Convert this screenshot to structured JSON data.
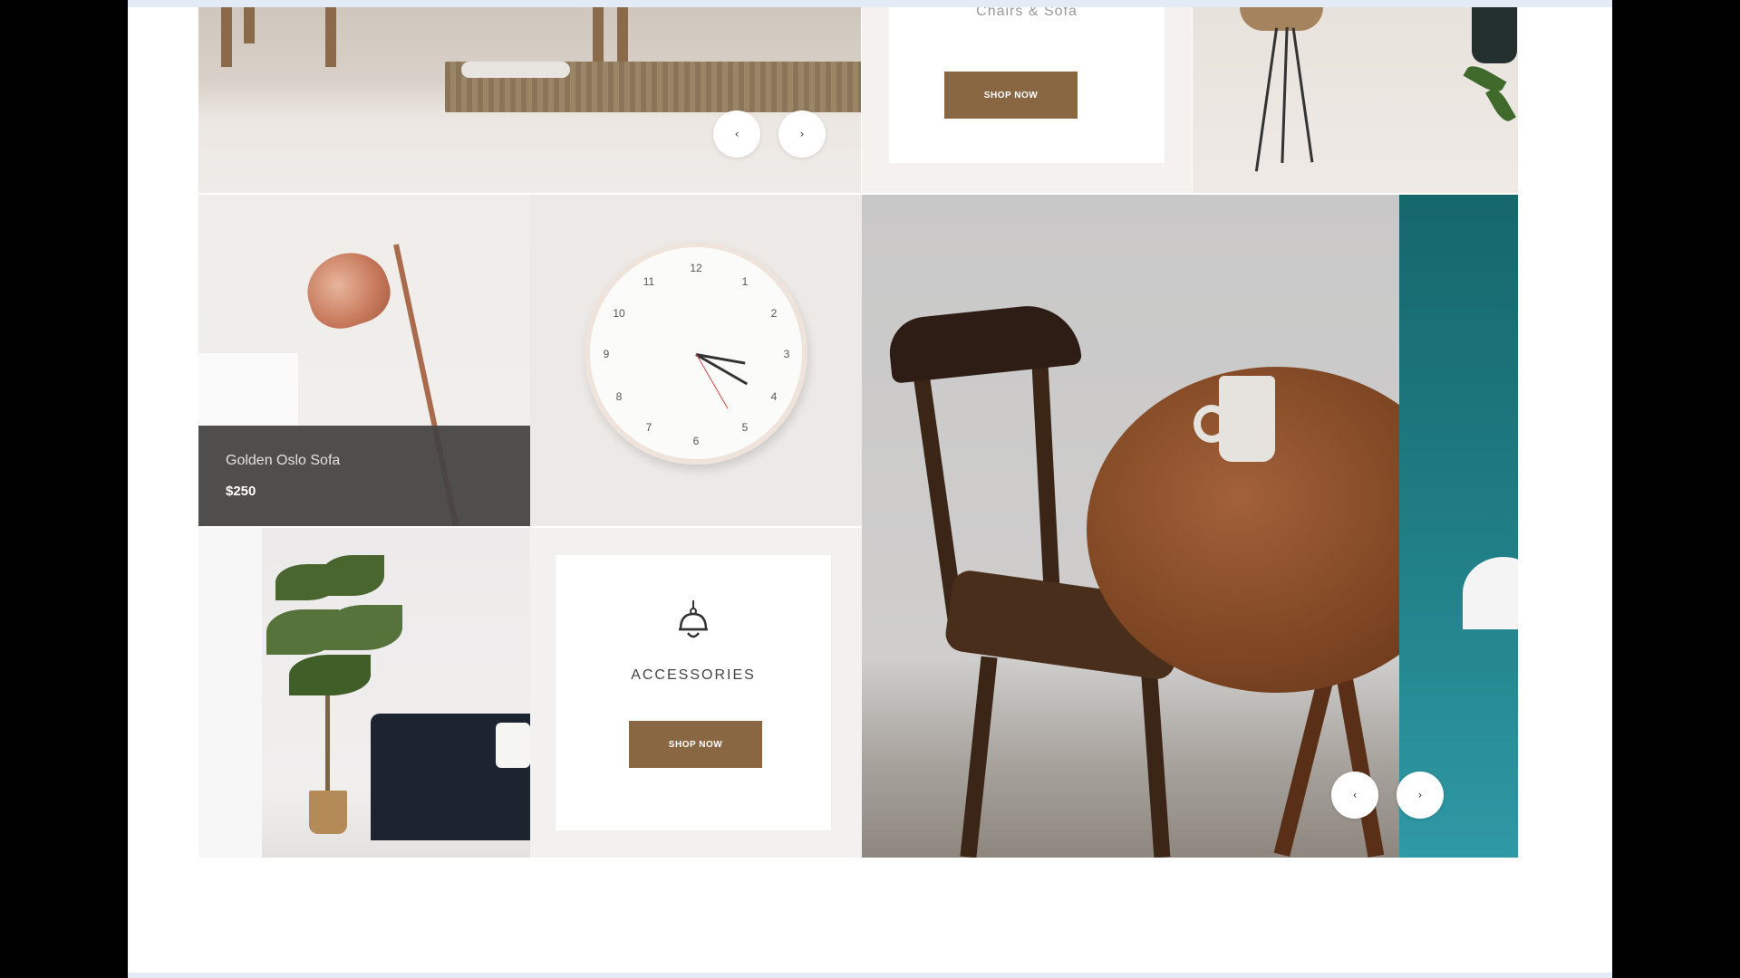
{
  "tiles": {
    "chairs_sofa": {
      "title": "Chairs & Sofa",
      "button": "SHOP NOW"
    },
    "product": {
      "name": "Golden Oslo Sofa",
      "price": "$250"
    },
    "accessories": {
      "label": "ACCESSORIES",
      "button": "SHOP NOW",
      "icon": "lamp-icon"
    }
  },
  "clock": {
    "numbers": [
      "12",
      "1",
      "2",
      "3",
      "4",
      "5",
      "6",
      "7",
      "8",
      "9",
      "10",
      "11"
    ]
  },
  "carousel_nav": {
    "prev": "‹",
    "next": "›"
  },
  "colors": {
    "button_brown": "#8a6743",
    "caption_dark": "#464442",
    "teal": "#1f7d84"
  }
}
